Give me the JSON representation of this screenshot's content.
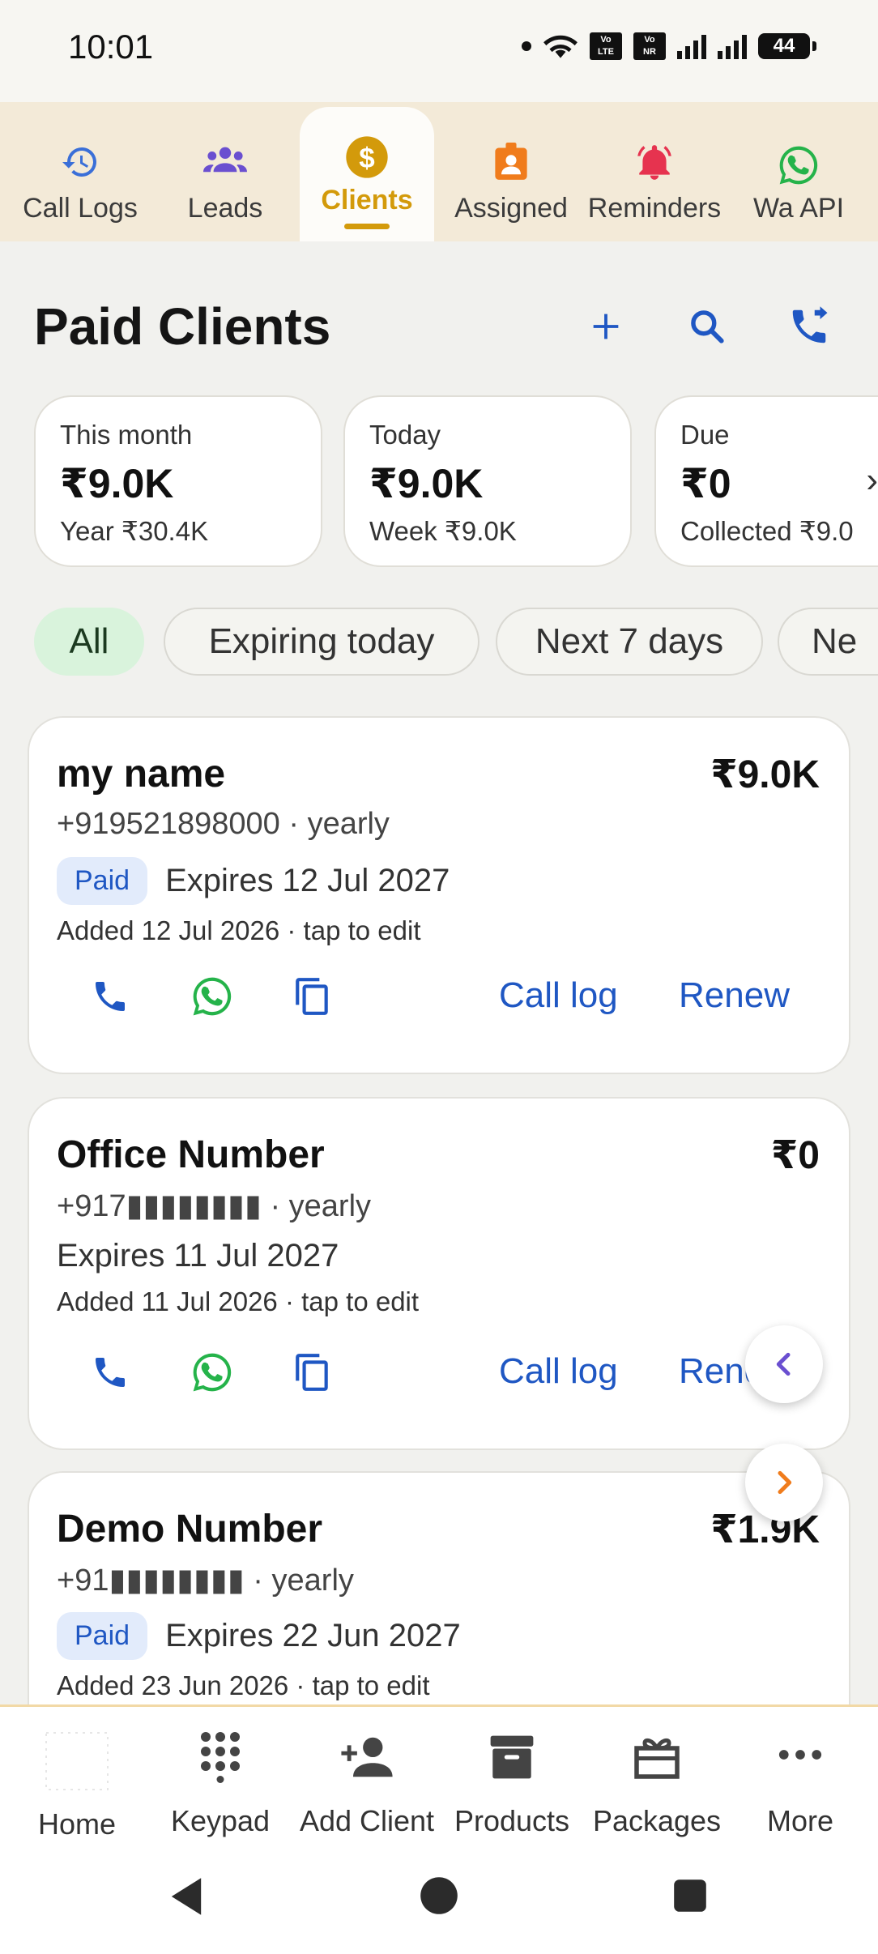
{
  "status_bar": {
    "time": "10:01",
    "sim1": "Vo 2\nLTE",
    "sim2": "Vo 1\nNR",
    "battery": "44"
  },
  "top_tabs": [
    {
      "label": "Call Logs",
      "icon": "history-icon",
      "color": "#3a6fd8"
    },
    {
      "label": "Leads",
      "icon": "group-icon",
      "color": "#6a4fd0"
    },
    {
      "label": "Clients",
      "icon": "dollar-icon",
      "color": "#d39a0b",
      "active": true
    },
    {
      "label": "Assigned",
      "icon": "badge-icon",
      "color": "#f07c1c"
    },
    {
      "label": "Reminders",
      "icon": "bell-icon",
      "color": "#e6334f"
    },
    {
      "label": "Wa API",
      "icon": "whatsapp-icon",
      "color": "#25b34a"
    }
  ],
  "header": {
    "title": "Paid Clients"
  },
  "stats": [
    {
      "label": "This month",
      "value": "₹9.0K",
      "sub": "Year ₹30.4K"
    },
    {
      "label": "Today",
      "value": "₹9.0K",
      "sub": "Week ₹9.0K"
    },
    {
      "label": "Due",
      "value": "₹0",
      "sub": "Collected ₹9.0"
    }
  ],
  "filters": [
    "All",
    "Expiring today",
    "Next 7 days",
    "Ne"
  ],
  "clients": [
    {
      "name": "my name",
      "amount": "₹9.0K",
      "phone": "+919521898000 · yearly",
      "badge": "Paid",
      "expires": "Expires 12 Jul 2027",
      "added": "Added 12 Jul 2026 · tap to edit",
      "call_log": "Call log",
      "renew": "Renew"
    },
    {
      "name": "Office Number",
      "amount": "₹0",
      "phone": "+917▮▮▮▮▮▮▮▮ · yearly",
      "badge": "",
      "expires": "Expires 11 Jul 2027",
      "added": "Added 11 Jul 2026 · tap to edit",
      "call_log": "Call log",
      "renew": "Renew"
    },
    {
      "name": "Demo Number",
      "amount": "₹1.9K",
      "phone": "+91▮▮▮▮▮▮▮▮ · yearly",
      "badge": "Paid",
      "expires": "Expires 22 Jun 2027",
      "added": "Added 23 Jun 2026 · tap to edit"
    }
  ],
  "bottom_nav": [
    {
      "label": "Home",
      "icon": "home-icon"
    },
    {
      "label": "Keypad",
      "icon": "dialpad-icon"
    },
    {
      "label": "Add Client",
      "icon": "add-person-icon"
    },
    {
      "label": "Products",
      "icon": "archive-box-icon"
    },
    {
      "label": "Packages",
      "icon": "gift-box-icon"
    },
    {
      "label": "More",
      "icon": "more-dots-icon"
    }
  ],
  "colors": {
    "accent_blue": "#1f57c3",
    "whatsapp_green": "#25b34a",
    "clients_gold": "#d39a0b",
    "chip_active_bg": "#d9f3dc"
  }
}
